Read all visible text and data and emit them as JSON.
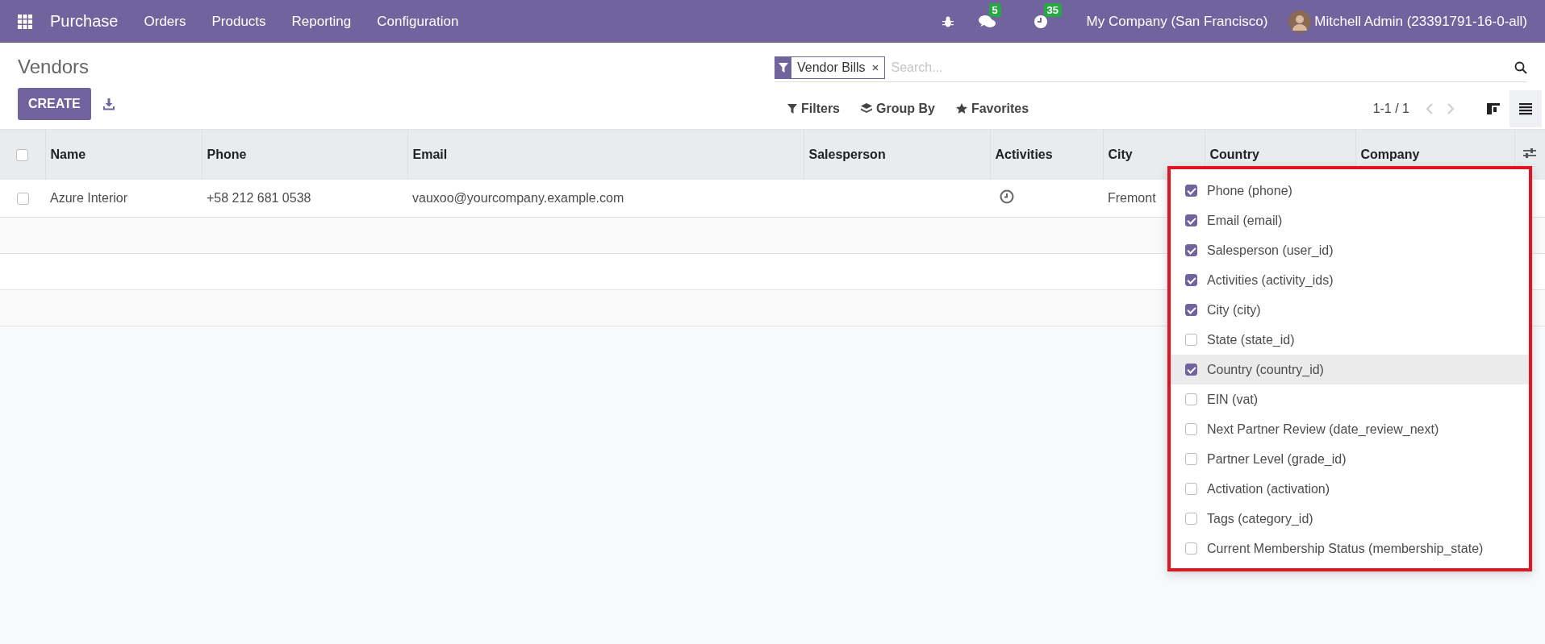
{
  "navbar": {
    "app_name": "Purchase",
    "menu": [
      "Orders",
      "Products",
      "Reporting",
      "Configuration"
    ],
    "messages_count": "5",
    "activities_count": "35",
    "company": "My Company (San Francisco)",
    "user": "Mitchell Admin (23391791-16-0-all)"
  },
  "control_panel": {
    "title": "Vendors",
    "create_label": "CREATE",
    "facet": "Vendor Bills",
    "search": {
      "placeholder": "Search..."
    },
    "filters": "Filters",
    "group_by": "Group By",
    "favorites": "Favorites",
    "pager": "1-1 / 1",
    "views": [
      {
        "kind": "kanban",
        "selected": false
      },
      {
        "kind": "list",
        "selected": true
      }
    ]
  },
  "table": {
    "header_checked": false,
    "columns": [
      "Name",
      "Phone",
      "Email",
      "Salesperson",
      "Activities",
      "City",
      "Country",
      "Company"
    ],
    "rows": [
      {
        "checked": false,
        "name": "Azure Interior",
        "phone": "+58 212 681 0538",
        "email": "vauxoo@yourcompany.example.com",
        "city": "Fremont"
      }
    ]
  },
  "column_options": [
    {
      "label": "Phone (phone)",
      "checked": true,
      "hovered": false
    },
    {
      "label": "Email (email)",
      "checked": true,
      "hovered": false
    },
    {
      "label": "Salesperson (user_id)",
      "checked": true,
      "hovered": false
    },
    {
      "label": "Activities (activity_ids)",
      "checked": true,
      "hovered": false
    },
    {
      "label": "City (city)",
      "checked": true,
      "hovered": false
    },
    {
      "label": "State (state_id)",
      "checked": false,
      "hovered": false
    },
    {
      "label": "Country (country_id)",
      "checked": true,
      "hovered": true
    },
    {
      "label": "EIN (vat)",
      "checked": false,
      "hovered": false
    },
    {
      "label": "Next Partner Review (date_review_next)",
      "checked": false,
      "hovered": false
    },
    {
      "label": "Partner Level (grade_id)",
      "checked": false,
      "hovered": false
    },
    {
      "label": "Activation (activation)",
      "checked": false,
      "hovered": false
    },
    {
      "label": "Tags (category_id)",
      "checked": false,
      "hovered": false
    },
    {
      "label": "Current Membership Status (membership_state)",
      "checked": false,
      "hovered": false
    }
  ]
}
